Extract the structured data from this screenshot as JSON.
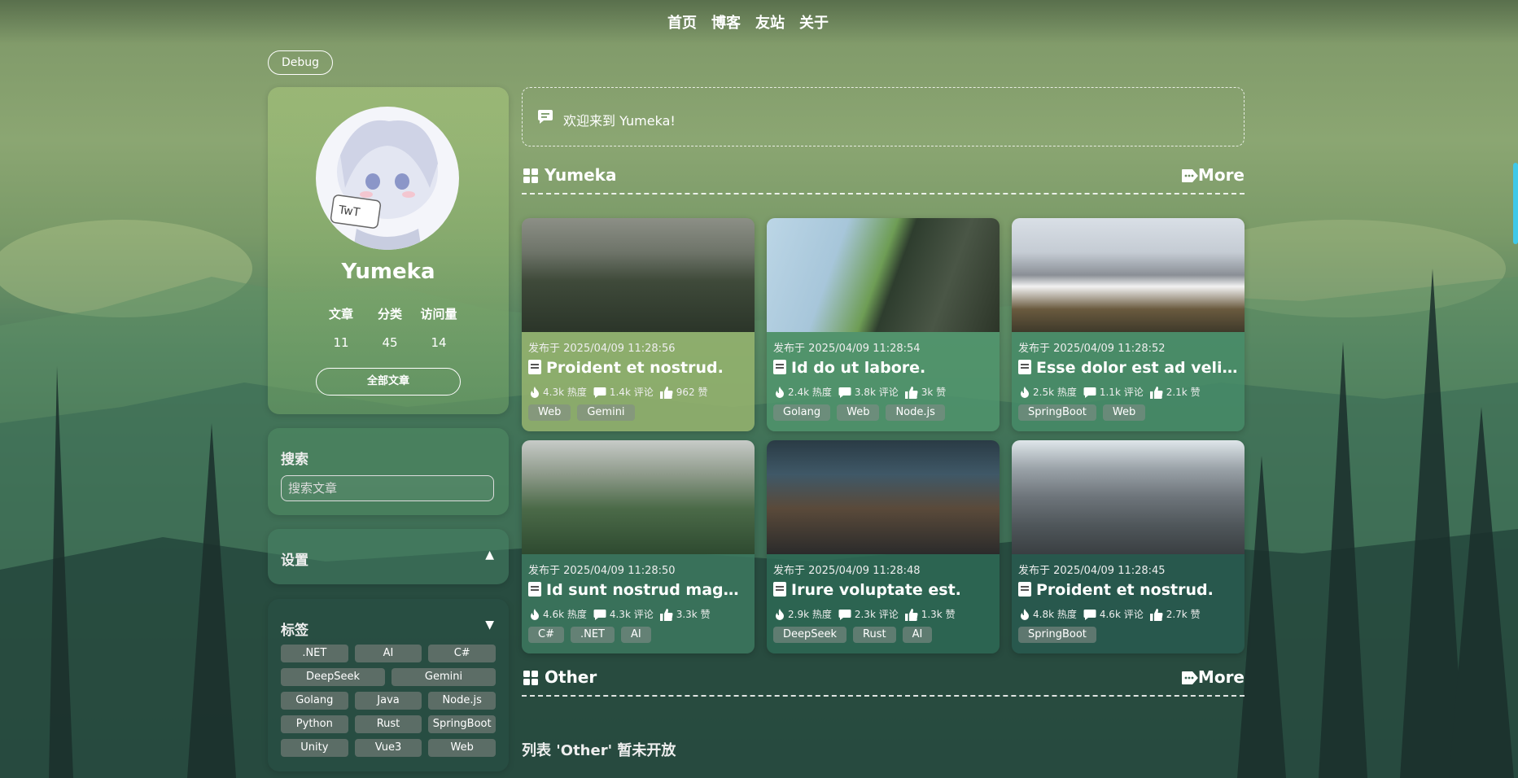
{
  "nav": {
    "items": [
      "首页",
      "博客",
      "友站",
      "关于"
    ]
  },
  "debug_label": "Debug",
  "profile": {
    "name": "Yumeka",
    "stats": [
      {
        "label": "文章",
        "value": "11"
      },
      {
        "label": "分类",
        "value": "45"
      },
      {
        "label": "访问量",
        "value": "14"
      }
    ],
    "all_posts_label": "全部文章"
  },
  "search": {
    "title": "搜索",
    "placeholder": "搜索文章"
  },
  "settings": {
    "title": "设置"
  },
  "tags_panel": {
    "title": "标签",
    "rows": [
      [
        ".NET",
        "AI",
        "C#"
      ],
      [
        "DeepSeek",
        "Gemini"
      ],
      [
        "Golang",
        "Java",
        "Node.js"
      ],
      [
        "Python",
        "Rust",
        "SpringBoot"
      ],
      [
        "Unity",
        "Vue3",
        "Web"
      ]
    ]
  },
  "welcome": "欢迎来到 Yumeka!",
  "sections": {
    "yumeka": {
      "title": "Yumeka",
      "more": "More"
    },
    "other": {
      "title": "Other",
      "more": "More",
      "empty": "列表 'Other' 暂未开放"
    }
  },
  "posts": [
    {
      "date": "发布于 2025/04/09 11:28:56",
      "title": "Proident et nostrud.",
      "heat": "4.3k 热度",
      "comments": "1.4k 评论",
      "likes": "962 赞",
      "tags": [
        "Web",
        "Gemini"
      ]
    },
    {
      "date": "发布于 2025/04/09 11:28:54",
      "title": "Id do ut labore.",
      "heat": "2.4k 热度",
      "comments": "3.8k 评论",
      "likes": "3k 赞",
      "tags": [
        "Golang",
        "Web",
        "Node.js"
      ]
    },
    {
      "date": "发布于 2025/04/09 11:28:52",
      "title": "Esse dolor est ad velit...",
      "heat": "2.5k 热度",
      "comments": "1.1k 评论",
      "likes": "2.1k 赞",
      "tags": [
        "SpringBoot",
        "Web"
      ]
    },
    {
      "date": "发布于 2025/04/09 11:28:50",
      "title": "Id sunt nostrud magna.",
      "heat": "4.6k 热度",
      "comments": "4.3k 评论",
      "likes": "3.3k 赞",
      "tags": [
        "C#",
        ".NET",
        "AI"
      ]
    },
    {
      "date": "发布于 2025/04/09 11:28:48",
      "title": "Irure voluptate est.",
      "heat": "2.9k 热度",
      "comments": "2.3k 评论",
      "likes": "1.3k 赞",
      "tags": [
        "DeepSeek",
        "Rust",
        "AI"
      ]
    },
    {
      "date": "发布于 2025/04/09 11:28:45",
      "title": "Proident et nostrud.",
      "heat": "4.8k 热度",
      "comments": "4.6k 评论",
      "likes": "2.7k 赞",
      "tags": [
        "SpringBoot"
      ]
    }
  ]
}
